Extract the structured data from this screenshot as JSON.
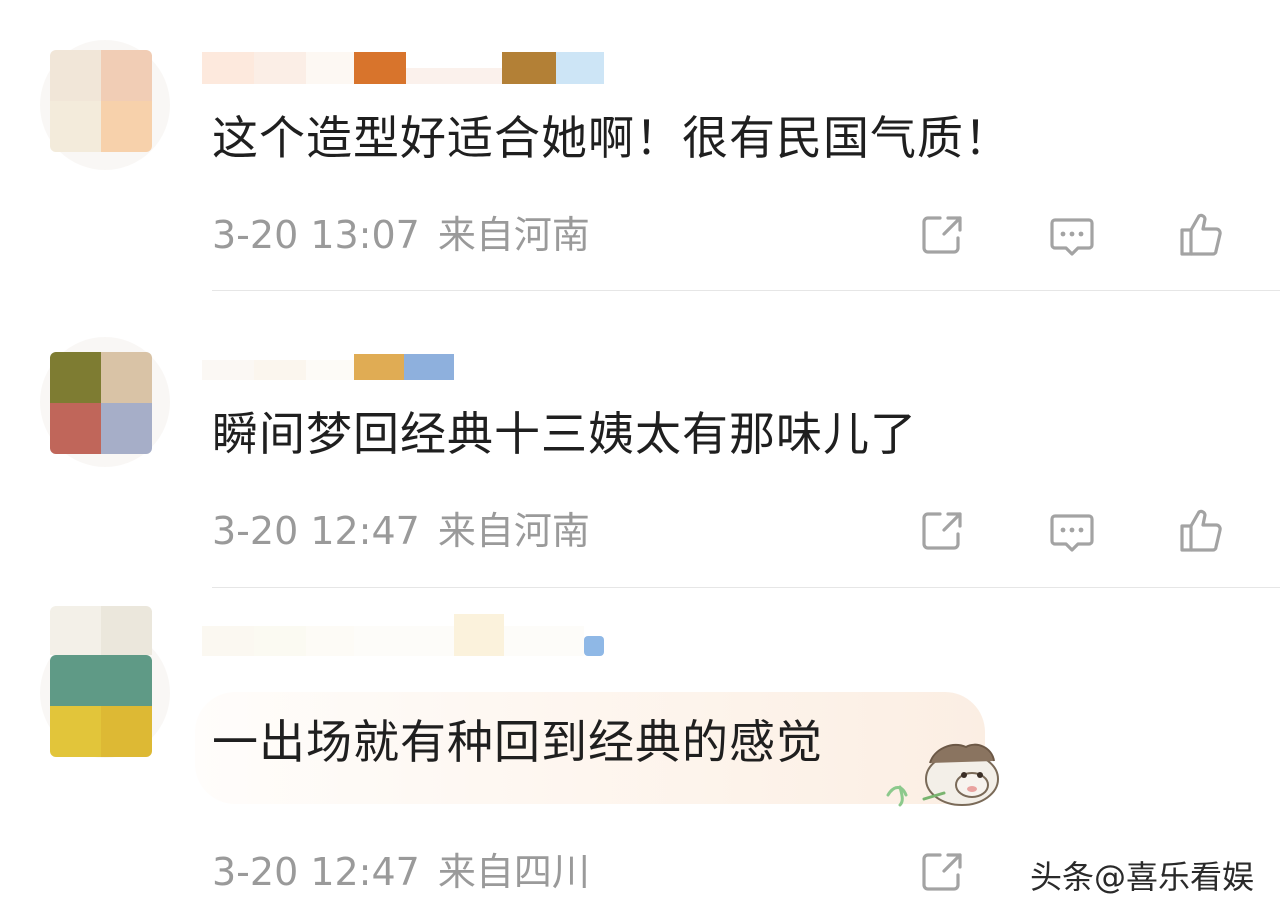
{
  "comments": [
    {
      "text": "这个造型好适合她啊！很有民国气质！",
      "time": "3-20 13:07",
      "location": "来自河南",
      "avatar_colors": [
        "#f1e6d8",
        "#f1cdb5",
        "#f3ebdb",
        "#f7d1ab"
      ],
      "name_blur_colors": [
        "#fde9dd",
        "#fbeee6",
        "#fdf8f3",
        "#d8742c",
        "#fbf1ec",
        "#b38036",
        "#cde5f6"
      ]
    },
    {
      "text": "瞬间梦回经典十三姨太有那味儿了",
      "time": "3-20 12:47",
      "location": "来自河南",
      "avatar_colors": [
        "#7e7c32",
        "#d9c3a6",
        "#c0665a",
        "#a6aec8"
      ],
      "name_blur_colors": [
        "#fbf8f4",
        "#fbf6ee",
        "#fdfbf7",
        "#e0ac54",
        "#8eb0dd"
      ]
    },
    {
      "text": "一出场就有种回到经典的感觉",
      "time": "3-20 12:47",
      "location": "来自四川",
      "avatar_colors": [
        "#ebe7dc",
        "#f3f0e8",
        "#5f9a86",
        "#e2c53a"
      ],
      "name_blur_colors": [
        "#fbf8f1",
        "#fbfaf2",
        "#fdfbf6",
        "#fbf2dc",
        "#fdfcf9",
        "#8fb8e6"
      ]
    }
  ],
  "actions": {
    "share_icon": "share-icon",
    "comment_icon": "comment-icon",
    "like_icon": "thumbs-up-icon"
  },
  "watermark": "头条@喜乐看娱"
}
